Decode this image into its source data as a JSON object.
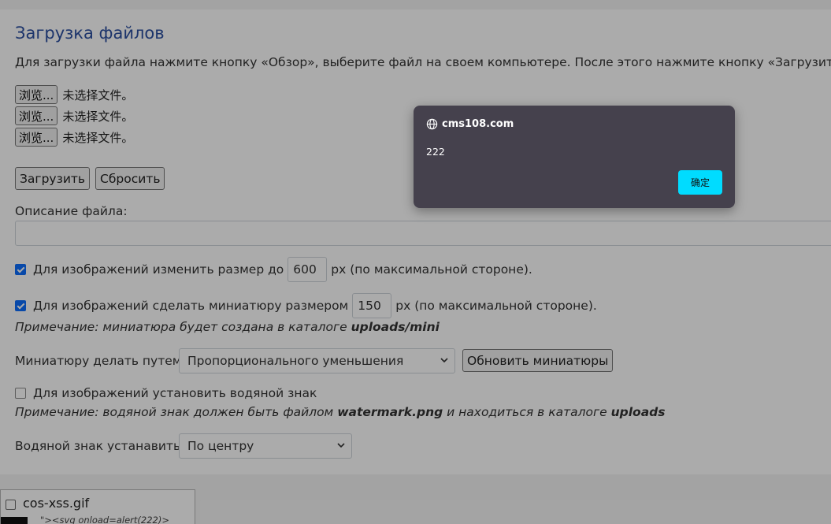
{
  "page": {
    "title": "Загрузка файлов",
    "intro": "Для загрузки файла нажмите кнопку «Обзор», выберите файл на своем компьютере. После этого нажмите кнопку «Загрузить». Разм"
  },
  "file_inputs": [
    {
      "button_label": "浏览...",
      "status": "未选择文件。"
    },
    {
      "button_label": "浏览...",
      "status": "未选择文件。"
    },
    {
      "button_label": "浏览...",
      "status": "未选择文件。"
    }
  ],
  "actions": {
    "upload_label": "Загрузить",
    "reset_label": "Сбросить"
  },
  "description": {
    "label": "Описание файла:",
    "value": ""
  },
  "resize_option": {
    "checked": true,
    "label_before": "Для изображений изменить размер до",
    "value": "600",
    "label_after": "px (по максимальной стороне)."
  },
  "thumbnail_option": {
    "checked": true,
    "label_before": "Для изображений сделать миниатюру размером",
    "value": "150",
    "label_after": "px (по максимальной стороне).",
    "note_text": "Примечание: миниатюра будет создана в каталоге ",
    "note_bold": "uploads/mini"
  },
  "thumbnail_method": {
    "label": "Миниатюру делать путем:",
    "selected": "Пропорционального уменьшения",
    "refresh_label": "Обновить миниатюры"
  },
  "watermark_option": {
    "checked": false,
    "label": "Для изображений установить водяной знак",
    "note_text1": "Примечание: водяной знак должен быть файлом ",
    "note_bold1": "watermark.png",
    "note_text2": " и находиться в каталоге ",
    "note_bold2": "uploads"
  },
  "watermark_position": {
    "label": "Водяной знак устанавить:",
    "selected": "По центру"
  },
  "file_list": [
    {
      "name": "cos-xss.gif",
      "caption": "\"><svg onload=alert(222)>"
    }
  ],
  "alert_dialog": {
    "origin": "cms108.com",
    "message": "222",
    "ok_label": "确定"
  },
  "colors": {
    "title": "#2a4ea0",
    "checkbox_accent": "#0d6efd",
    "dialog_bg": "#45414d",
    "dialog_ok": "#00dcff"
  }
}
